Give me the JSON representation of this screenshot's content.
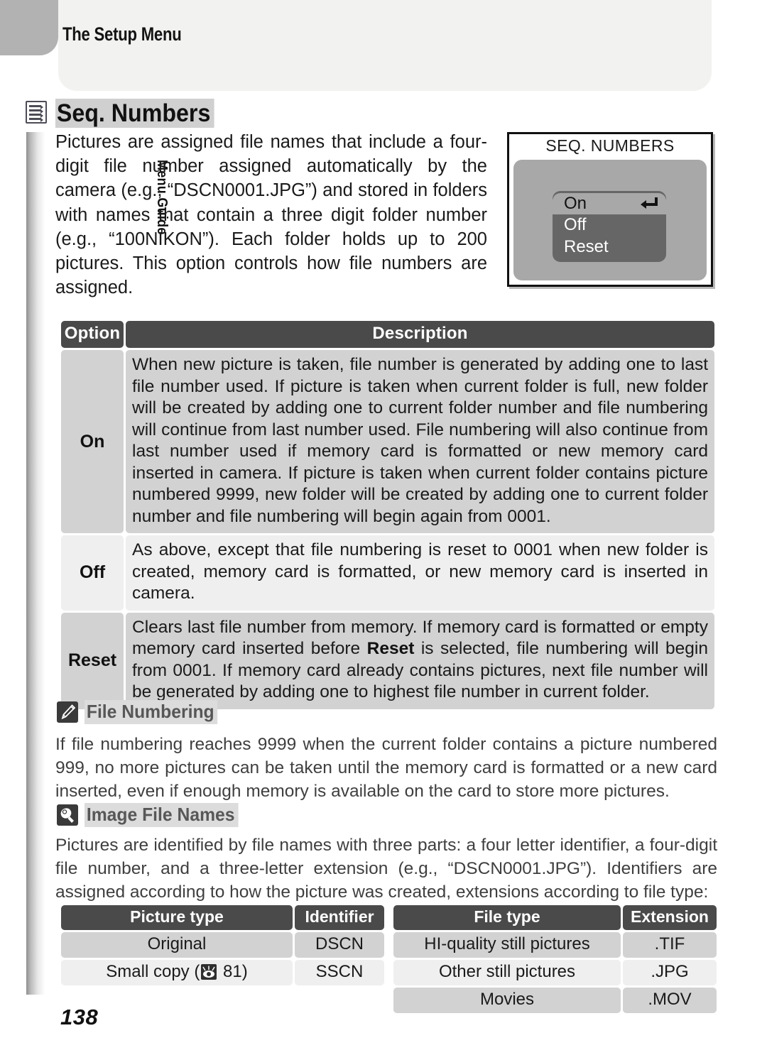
{
  "page": {
    "running_head": "The Setup Menu",
    "side_tab": "Menu Guide",
    "page_number": "138"
  },
  "section": {
    "icon": "menu-list-icon",
    "title": "Seq. Numbers",
    "intro": "Pictures are assigned file names that include a four-digit file number assigned automatically by the camera (e.g., “DSCN0001.JPG”) and stored in folders with names that contain a three digit folder number (e.g., “100NIKON”).  Each folder holds up to 200 pictures.  This option controls how file numbers are assigned."
  },
  "lcd": {
    "title": "SEQ. NUMBERS",
    "items": [
      {
        "label": "On",
        "selected": true,
        "enter_mark": true
      },
      {
        "label": "Off",
        "selected": false,
        "enter_mark": false
      },
      {
        "label": "Reset",
        "selected": false,
        "enter_mark": false
      }
    ]
  },
  "option_table": {
    "headers": [
      "Option",
      "Description"
    ],
    "rows": [
      {
        "option": "On",
        "description": "When new picture is taken, file number is generated by adding one to last file number used.  If picture is taken when current folder is full, new folder will be created by adding one to current folder number and file numbering will continue from last number used.  File numbering will also continue from last number used if memory card is formatted or new memory card inserted in camera.  If picture is taken when current folder contains picture numbered 9999, new folder will be created by adding one to current folder number and file numbering will begin again from 0001."
      },
      {
        "option": "Off",
        "description": "As above, except that file numbering is reset to 0001 when new folder is created, memory card is formatted, or new memory card is inserted in camera."
      },
      {
        "option": "Reset",
        "description_pre": "Clears last file number from memory.  If memory card is formatted or empty memory card inserted before ",
        "description_bold": "Reset",
        "description_post": " is selected, file numbering will begin from 0001.  If memory card already contains pictures, next file number will be generated by adding one to highest file number in current folder."
      }
    ]
  },
  "notes": [
    {
      "icon": "pencil-icon",
      "title": "File Numbering",
      "body": "If file numbering reaches 9999 when the current folder contains a picture numbered 999, no more pictures can be taken until the memory card is formatted or a new card inserted, even if enough memory is available on the card to store more pictures."
    },
    {
      "icon": "lightbulb-icon",
      "title": "Image File Names",
      "body": "Pictures are identified by file names with three parts: a four letter identifier, a four-digit file number, and a three-letter extension (e.g., “DSCN0001.JPG”).  Identifiers are assigned according to how the picture was created, extensions according to file type:"
    }
  ],
  "picture_type_table": {
    "headers": [
      "Picture type",
      "Identifier"
    ],
    "rows": [
      {
        "type_pre": "Original",
        "type_icon": false,
        "type_post": "",
        "identifier": "DSCN"
      },
      {
        "type_pre": "Small copy (",
        "type_icon": true,
        "type_post": " 81)",
        "identifier": "SSCN"
      }
    ]
  },
  "file_type_table": {
    "headers": [
      "File type",
      "Extension"
    ],
    "rows": [
      {
        "type": "HI-quality still pictures",
        "extension": ".TIF"
      },
      {
        "type": "Other still pictures",
        "extension": ".JPG"
      },
      {
        "type": "Movies",
        "extension": ".MOV"
      }
    ]
  },
  "colors": {
    "table_header_bg": "#4a4a4a",
    "row_dark": "#d2d2d2",
    "row_light": "#efefef",
    "header_panel": "#f2f2f0",
    "corner_block": "#b2b2b2",
    "note_title_bg": "#dcdcdc",
    "lcd_screen": "#a8a8a8",
    "lcd_menu": "#666666"
  }
}
